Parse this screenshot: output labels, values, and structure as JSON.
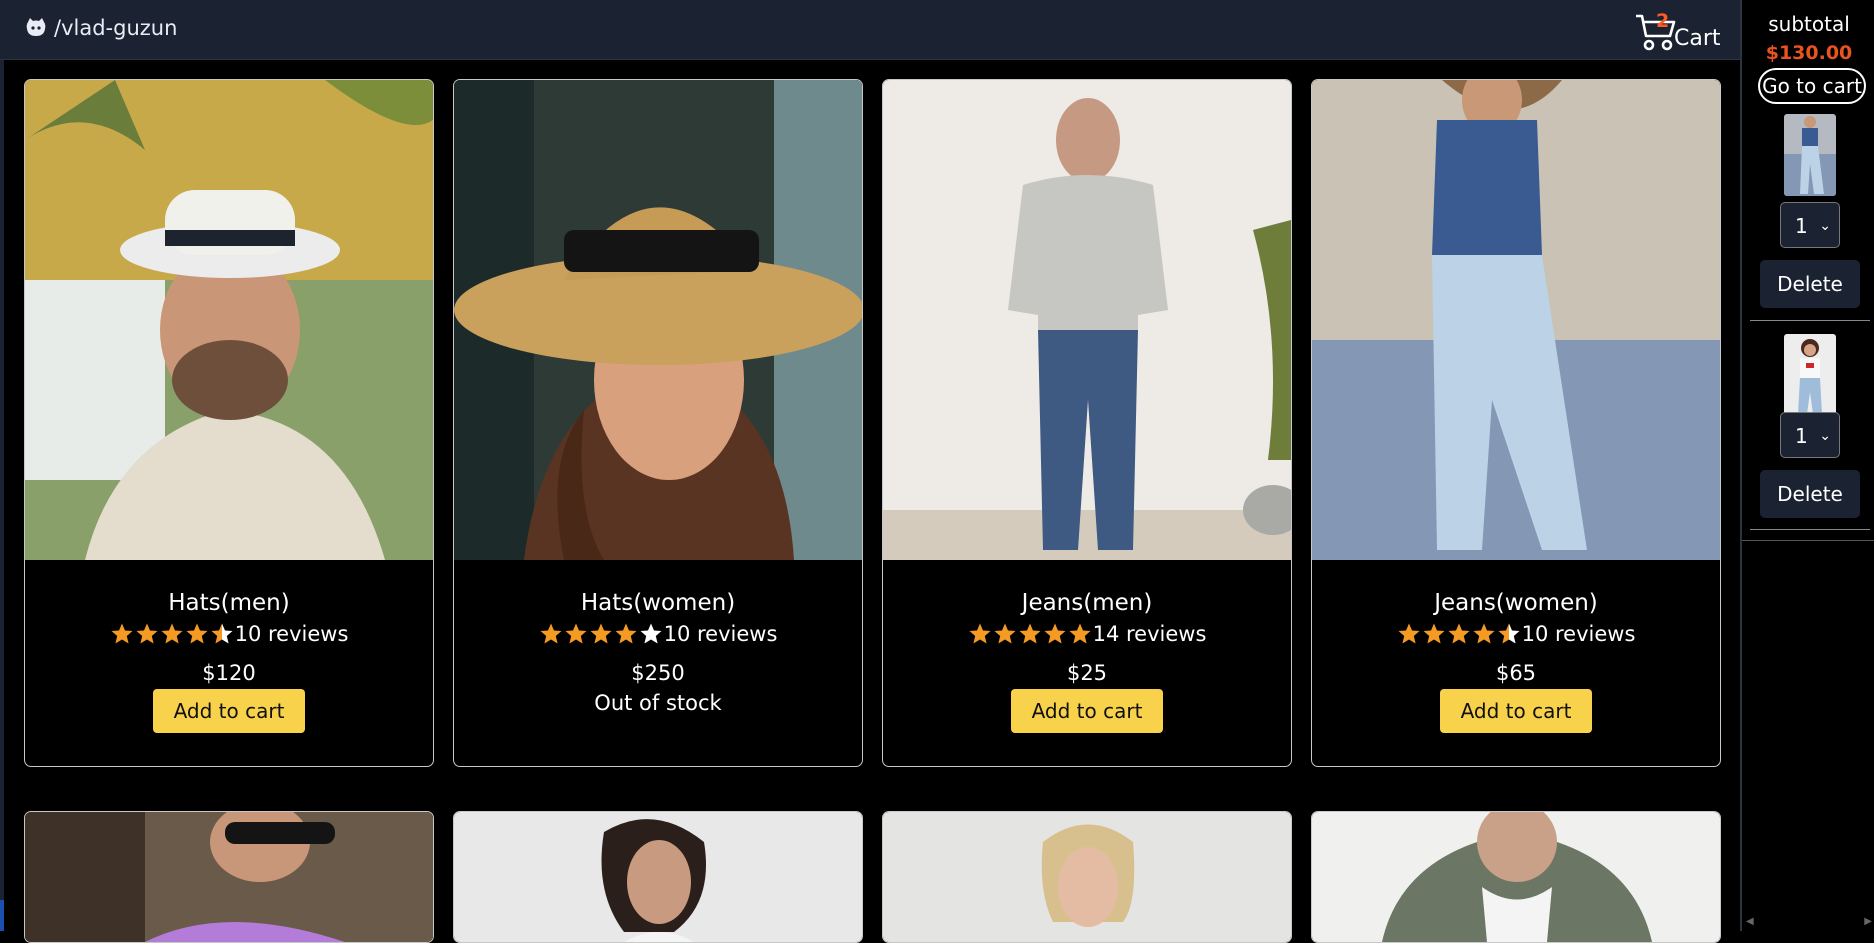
{
  "header": {
    "logo_text": "/vlad-guzun",
    "logo_icon": "github-icon",
    "cart_count": "2",
    "cart_label": "Cart",
    "cart_icon": "shopping-cart-icon",
    "colors": {
      "bar": "#1b2232",
      "count": "#ff5a1f"
    }
  },
  "products": [
    {
      "name": "Hats(men)",
      "stars": 4.5,
      "reviews": "10 reviews",
      "price": "$120",
      "action": "Add to cart",
      "in_stock": true
    },
    {
      "name": "Hats(women)",
      "stars": 4.0,
      "reviews": "10 reviews",
      "price": "$250",
      "action": "Out of stock",
      "in_stock": false
    },
    {
      "name": "Jeans(men)",
      "stars": 5.0,
      "reviews": "14 reviews",
      "price": "$25",
      "action": "Add to cart",
      "in_stock": true
    },
    {
      "name": "Jeans(women)",
      "stars": 4.5,
      "reviews": "10 reviews",
      "price": "$65",
      "action": "Add to cart",
      "in_stock": true
    }
  ],
  "sidebar": {
    "subtotal_label": "subtotal",
    "subtotal_value": "$130.00",
    "goto_label": "Go to cart",
    "items": [
      {
        "qty": "1",
        "delete_label": "Delete"
      },
      {
        "qty": "1",
        "delete_label": "Delete"
      }
    ]
  },
  "colors": {
    "button": "#f8d24a",
    "star": "#f59a23",
    "price_accent": "#e8531f"
  }
}
